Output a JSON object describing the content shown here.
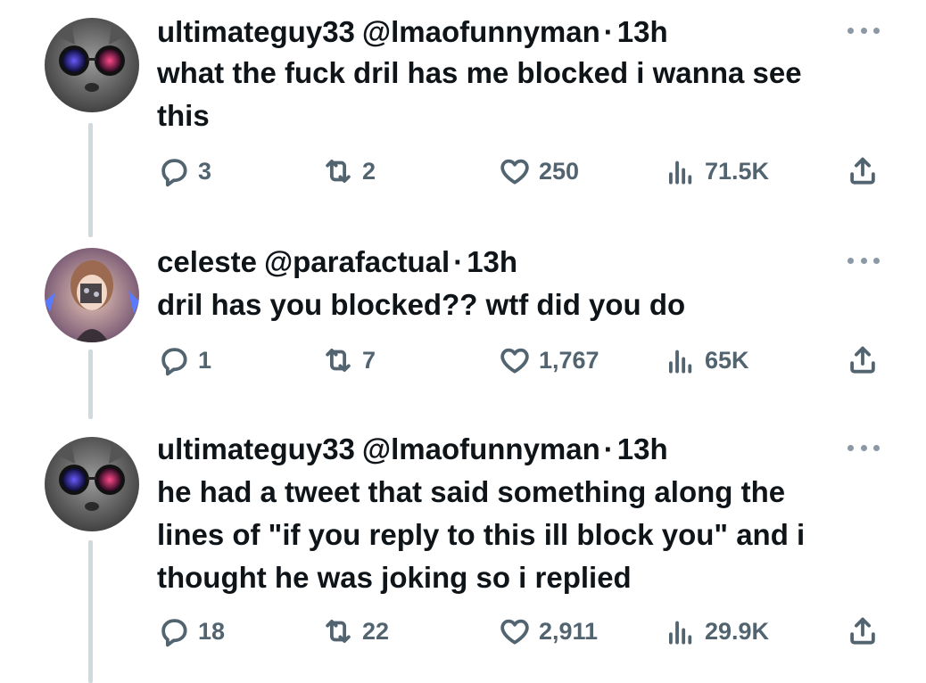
{
  "tweets": [
    {
      "display_name": "ultimateguy33",
      "handle": "@lmaofunnyman",
      "separator": "·",
      "time": "13h",
      "text": "what the fuck dril has me blocked i wanna see\nthis",
      "replies": "3",
      "retweets": "2",
      "likes": "250",
      "views": "71.5K",
      "avatar_icon": "cat-avatar-icon"
    },
    {
      "display_name": "celeste",
      "handle": "@parafactual",
      "separator": "·",
      "time": "13h",
      "text": "dril has you blocked?? wtf did you do",
      "replies": "1",
      "retweets": "7",
      "likes": "1,767",
      "views": "65K",
      "avatar_icon": "anime-avatar-icon"
    },
    {
      "display_name": "ultimateguy33",
      "handle": "@lmaofunnyman",
      "separator": "·",
      "time": "13h",
      "text": "he had a tweet that said something along the\nlines of \"if you reply to this ill block you\" and i\nthought he was joking so i replied",
      "replies": "18",
      "retweets": "22",
      "likes": "2,911",
      "views": "29.9K",
      "avatar_icon": "cat-avatar-icon"
    }
  ],
  "colors": {
    "text_primary": "#0f1419",
    "text_secondary": "#536471",
    "thread_line": "#cfd9de",
    "more_dots": "#8b98a5"
  }
}
